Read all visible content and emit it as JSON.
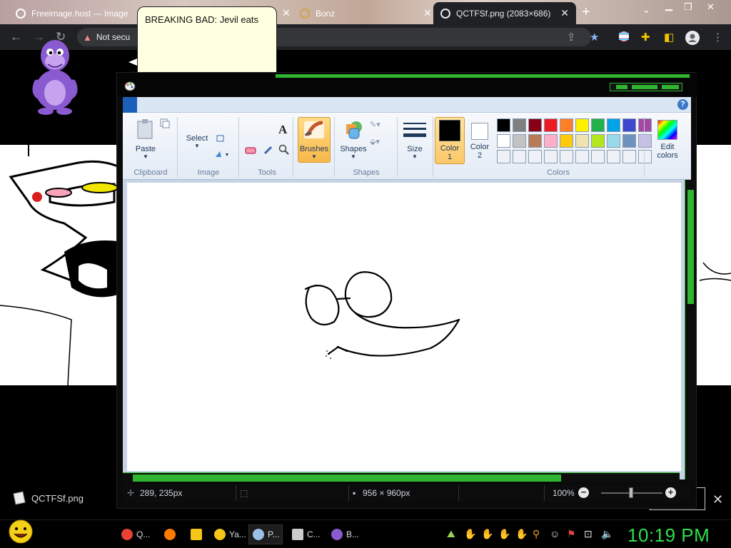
{
  "browser": {
    "tabs": [
      {
        "title": "Freeimage.host — Image",
        "active": false
      },
      {
        "title": "",
        "active": false
      },
      {
        "title": "Bonz",
        "active": false
      },
      {
        "title": "QCTFSf.png (2083×686)",
        "active": true
      }
    ],
    "new_tab_label": "+",
    "address": {
      "security_label": "Not secu"
    }
  },
  "sticky_note": {
    "text": "BREAKING BAD: Jevil eats"
  },
  "webpage": {
    "file_name": "QCTFSf.png",
    "close_label": "✕"
  },
  "paint": {
    "ribbon": {
      "clipboard": {
        "paste_label": "Paste",
        "group_label": "Clipboard"
      },
      "image": {
        "select_label": "Select",
        "group_label": "Image"
      },
      "tools": {
        "group_label": "Tools",
        "text_tool": "A"
      },
      "brushes": {
        "label": "Brushes"
      },
      "shapes": {
        "label": "Shapes",
        "group_label": "Shapes"
      },
      "size": {
        "label": "Size"
      },
      "color1": {
        "label_line1": "Color",
        "label_line2": "1",
        "value": "#000000"
      },
      "color2": {
        "label_line1": "Color",
        "label_line2": "2",
        "value": "#ffffff"
      },
      "colors": {
        "group_label": "Colors"
      },
      "edit_colors": {
        "line1": "Edit",
        "line2": "colors"
      },
      "help_label": "?"
    },
    "palette_row1": [
      "#000000",
      "#7f7f7f",
      "#880015",
      "#ed1c24",
      "#ff7f27",
      "#fff200",
      "#22b14c",
      "#00a2e8",
      "#3f48cc",
      "#a349a4"
    ],
    "palette_row2": [
      "#ffffff",
      "#c3c3c3",
      "#b97a57",
      "#ffaec9",
      "#ffc90e",
      "#efe4b0",
      "#b5e61d",
      "#99d9ea",
      "#7092be",
      "#c8bfe7"
    ],
    "status": {
      "cursor_pos": "289, 235px",
      "image_size": "956 × 960px",
      "zoom": "100%"
    },
    "accent": "#2fb52f"
  },
  "taskbar": {
    "items": [
      {
        "label": "Q...",
        "color": "#e94235"
      },
      {
        "label": "",
        "color": "#ff7a00"
      },
      {
        "label": "",
        "color": "#f5c518"
      },
      {
        "label": "Ya...",
        "color": "#f5c518"
      },
      {
        "label": "P...",
        "color": "#9bc0e8"
      },
      {
        "label": "C...",
        "color": "#cccccc"
      },
      {
        "label": "B...",
        "color": "#8a5ad0"
      }
    ],
    "clock": "10:19 PM"
  }
}
